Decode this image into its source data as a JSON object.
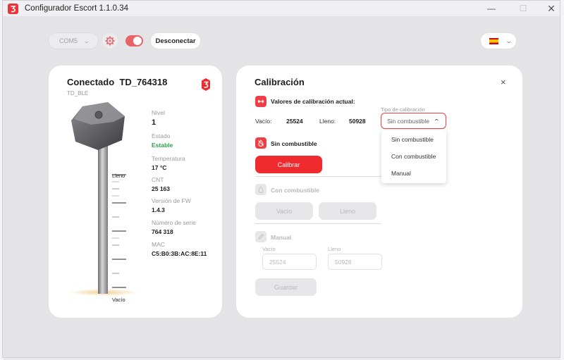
{
  "window": {
    "title": "Configurador Escort 1.1.0.34",
    "minimize": "—",
    "maximize": "☐",
    "close": "✕"
  },
  "toolbar": {
    "port_value": "COM5",
    "port_chevron": "⌄",
    "connected_toggle": true,
    "disconnect_label": "Desconectar",
    "language_flag": "es",
    "language_chevron": "⌄"
  },
  "device": {
    "title": "Conectado  TD_764318",
    "subtitle": "TD_BLE",
    "gauge_top_label": "Lleno",
    "gauge_bottom_label": "Vacío",
    "fields": [
      {
        "label": "Nivel",
        "value": "1"
      },
      {
        "label": "Estado",
        "value": "Estable"
      },
      {
        "label": "Temperatura",
        "value": "17 °C"
      },
      {
        "label": "CNT",
        "value": "25 163"
      },
      {
        "label": "Versión de FW",
        "value": "1.4.3"
      },
      {
        "label": "Número de serie",
        "value": "764 318"
      },
      {
        "label": "MAC",
        "value": "C5:B0:3B:AC:8E:11"
      }
    ],
    "colors": {
      "status_ok": "#2aa04a",
      "brand": "#ee2a2f"
    }
  },
  "calibration": {
    "title": "Calibración",
    "close": "×",
    "current_heading": "Valores de calibración actual:",
    "empty_label": "Vacío:",
    "empty_value": "25524",
    "full_label": "Lleno:",
    "full_value": "50928",
    "type_caption": "Tipo de calibración",
    "type_selected": "Sin combustible",
    "type_options": [
      "Sin combustible",
      "Con combustible",
      "Manual"
    ],
    "section_no_fuel": "Sin combustible",
    "calibrate_button": "Calibrar",
    "section_with_fuel": "Con combustible",
    "btn_empty": "Vacío",
    "btn_full": "Lleno",
    "section_manual": "Manual",
    "manual_empty_label": "Vacío",
    "manual_full_label": "Lleno",
    "manual_empty_value": "25524",
    "manual_full_value": "50928",
    "save_button": "Guardar"
  }
}
